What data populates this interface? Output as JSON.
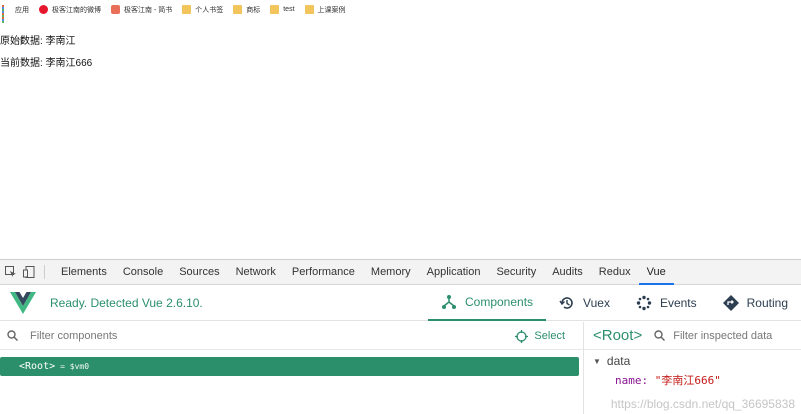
{
  "bookmarks": {
    "items": [
      {
        "label": "应用",
        "icon": "apps-icon"
      },
      {
        "label": "极客江南的微博",
        "icon": "weibo-icon"
      },
      {
        "label": "极客江南 - 简书",
        "icon": "jianshu-icon"
      },
      {
        "label": "个人书签",
        "icon": "folder-icon"
      },
      {
        "label": "商标",
        "icon": "folder-icon"
      },
      {
        "label": "test",
        "icon": "folder-icon"
      },
      {
        "label": "上课案例",
        "icon": "folder-icon"
      }
    ]
  },
  "page": {
    "original_line": "原始数据: 李南江",
    "current_line": "当前数据: 李南江666"
  },
  "devtools": {
    "tabs": [
      "Elements",
      "Console",
      "Sources",
      "Network",
      "Performance",
      "Memory",
      "Application",
      "Security",
      "Audits",
      "Redux",
      "Vue"
    ],
    "active_tab": "Vue"
  },
  "vue": {
    "status": "Ready. Detected Vue 2.6.10.",
    "nav": {
      "components": "Components",
      "vuex": "Vuex",
      "events": "Events",
      "routing": "Routing"
    },
    "filter_placeholder": "Filter components",
    "select_label": "Select",
    "root_node": "<Root>",
    "root_vm": "= $vm0",
    "inspector": {
      "root_title": "<Root>",
      "filter_placeholder": "Filter inspected data",
      "section": "data",
      "prop_key": "name:",
      "prop_value": "\"李南江666\""
    }
  },
  "watermark": "https://blog.csdn.net/qq_36695838",
  "colors": {
    "vue_green": "#2c8f6b",
    "devtools_active_blue": "#1a73e8"
  }
}
